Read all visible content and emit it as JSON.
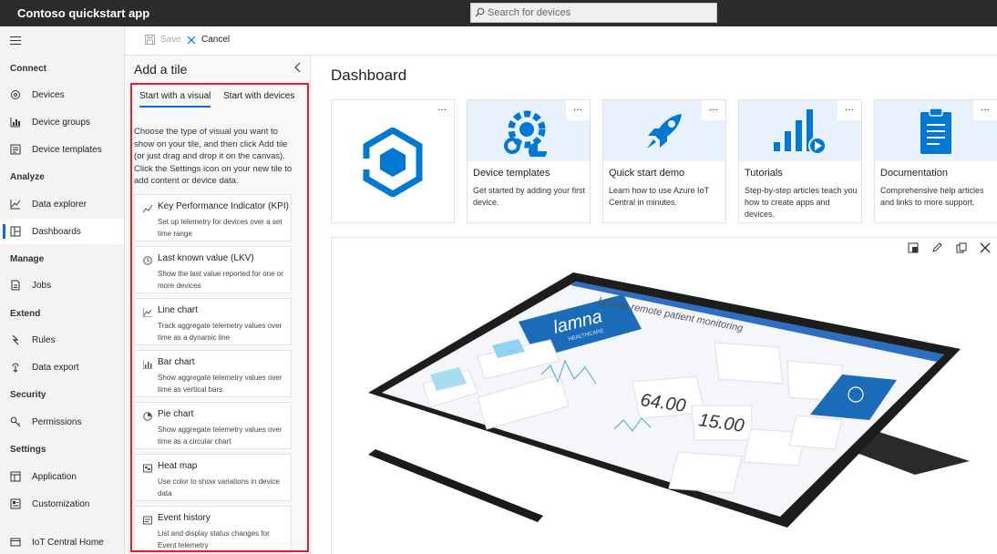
{
  "app": {
    "title": "Contoso quickstart app"
  },
  "search": {
    "placeholder": "Search for devices"
  },
  "nav": {
    "sections": {
      "connect": "Connect",
      "analyze": "Analyze",
      "manage": "Manage",
      "extend": "Extend",
      "security": "Security",
      "settings": "Settings"
    },
    "items": {
      "devices": "Devices",
      "device_groups": "Device groups",
      "device_templates": "Device templates",
      "data_explorer": "Data explorer",
      "dashboards": "Dashboards",
      "jobs": "Jobs",
      "rules": "Rules",
      "data_export": "Data export",
      "permissions": "Permissions",
      "application": "Application",
      "customization": "Customization",
      "iot_central_home": "IoT Central Home"
    },
    "active": "dashboards"
  },
  "toolbar": {
    "save_label": "Save",
    "cancel_label": "Cancel"
  },
  "panel": {
    "title": "Add a tile",
    "tabs": [
      "Start with a visual",
      "Start with devices"
    ],
    "active_tab": 0,
    "description": "Choose the type of visual you want to show on your tile, and then click Add tile (or just drag and drop it on the canvas). Click the Settings icon on your new tile to add content or device data.",
    "visuals": [
      {
        "icon": "kpi-icon",
        "title": "Key Performance Indicator (KPI)",
        "desc": "Set up telemetry for devices over a set time range"
      },
      {
        "icon": "clock-icon",
        "title": "Last known value (LKV)",
        "desc": "Show the last value reported for one or more devices"
      },
      {
        "icon": "line-chart-icon",
        "title": "Line chart",
        "desc": "Track aggregate telemetry values over time as a dynamic line"
      },
      {
        "icon": "bar-chart-icon",
        "title": "Bar chart",
        "desc": "Show aggregate telemetry values over time as vertical bars"
      },
      {
        "icon": "pie-chart-icon",
        "title": "Pie chart",
        "desc": "Show aggregate telemetry values over time as a circular chart"
      },
      {
        "icon": "heat-map-icon",
        "title": "Heat map",
        "desc": "Use color to show variations in device data"
      },
      {
        "icon": "event-history-icon",
        "title": "Event history",
        "desc": "List and display status changes for Event telemetry"
      }
    ]
  },
  "dashboard": {
    "title": "Dashboard",
    "more_label": "...",
    "tiles": [
      {
        "icon": "iot-central-logo-icon",
        "title": "",
        "desc": ""
      },
      {
        "icon": "gears-icon",
        "title": "Device templates",
        "desc": "Get started by adding your first device."
      },
      {
        "icon": "rocket-icon",
        "title": "Quick start demo",
        "desc": "Learn how to use Azure IoT Central in minutes."
      },
      {
        "icon": "bar-chart-play-icon",
        "title": "Tutorials",
        "desc": "Step-by-step articles teach you how to create apps and devices."
      },
      {
        "icon": "document-icon",
        "title": "Documentation",
        "desc": "Comprehensive help articles and links to more support."
      }
    ],
    "image_tile": {
      "screen_brand": "lamna",
      "screen_brand_sub": "HEALTHCARE",
      "screen_heading": "Lamna remote patient monitoring",
      "screen_values": [
        "64.00",
        "15.00"
      ],
      "actions": [
        "fit-icon",
        "edit-icon",
        "copy-icon",
        "close-icon"
      ]
    }
  },
  "colors": {
    "accent": "#0a6fd6",
    "highlight": "#e0202f",
    "topbar": "#2b2b2b",
    "tile_header": "#e8f2fd",
    "icon_blue": "#0078d4"
  }
}
